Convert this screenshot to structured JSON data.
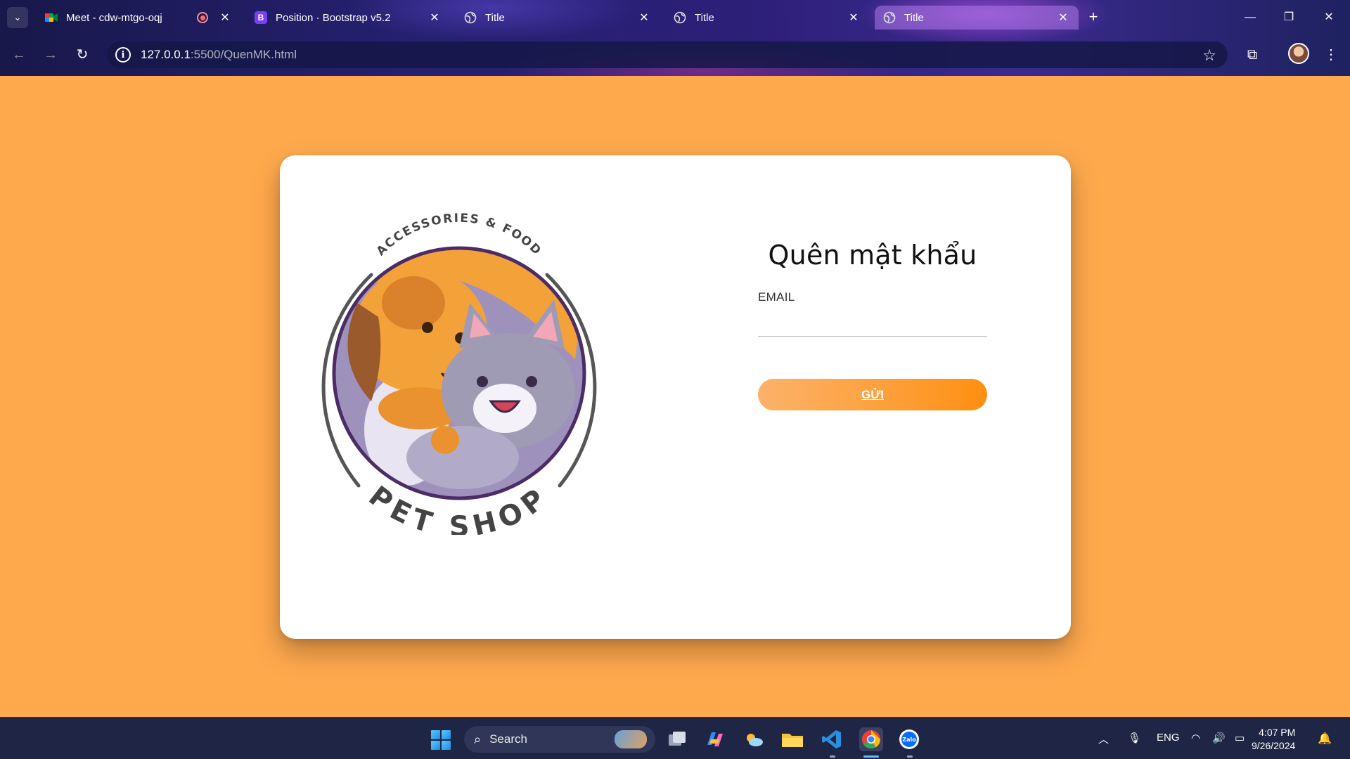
{
  "browser": {
    "tabs": [
      {
        "title": "Meet - cdw-mtgo-oqj",
        "favicon": "google-meet-icon",
        "recording": true
      },
      {
        "title": "Position · Bootstrap v5.2",
        "favicon": "bootstrap-icon",
        "favicon_text": "B"
      },
      {
        "title": "Title",
        "favicon": "globe-icon"
      },
      {
        "title": "Title",
        "favicon": "globe-icon"
      },
      {
        "title": "Title",
        "favicon": "globe-icon",
        "active": true
      }
    ],
    "url_host": "127.0.0.1",
    "url_path": ":5500/QuenMK.html"
  },
  "page": {
    "background_color": "#ffa94d",
    "logo": {
      "top_text": "ACCESSORIES & FOOD",
      "bottom_text": "PET SHOP"
    },
    "form": {
      "title": "Quên mật khẩu",
      "email_label": "EMAIL",
      "email_value": "",
      "submit_label": "GỬI"
    }
  },
  "taskbar": {
    "search_label": "Search",
    "language": "ENG",
    "time": "4:07 PM",
    "date": "9/26/2024",
    "apps": [
      "file-explorer-icon",
      "copilot-icon",
      "weather-icon",
      "folder-icon",
      "vscode-icon",
      "chrome-icon",
      "zalo-icon"
    ]
  }
}
